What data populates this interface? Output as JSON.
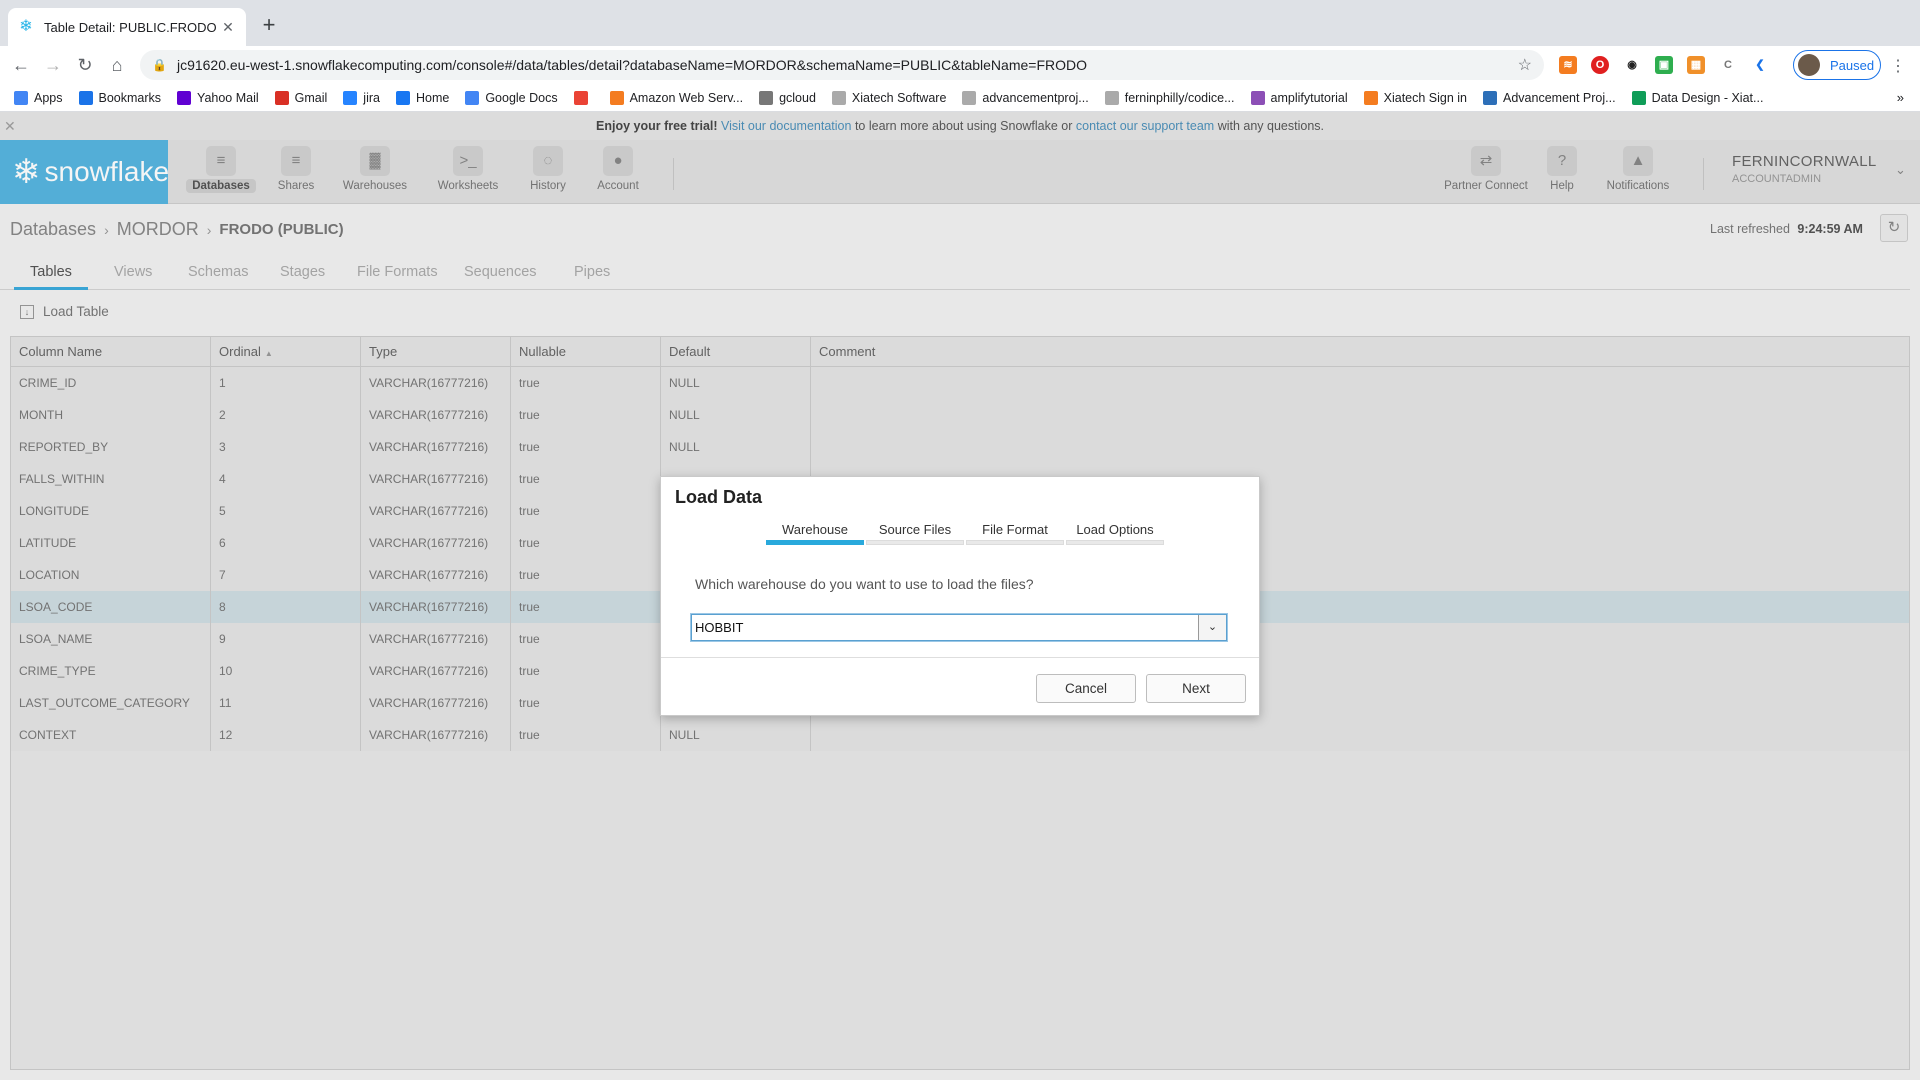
{
  "browser": {
    "tab_title": "Table Detail: PUBLIC.FRODO",
    "url": "jc91620.eu-west-1.snowflakecomputing.com/console#/data/tables/detail?databaseName=MORDOR&schemaName=PUBLIC&tableName=FRODO",
    "profile_label": "Paused",
    "bookmarks": [
      {
        "label": "Apps",
        "icon": "apps-grid-icon",
        "color": "#4285f4"
      },
      {
        "label": "Bookmarks",
        "icon": "star-icon",
        "color": "#1a73e8"
      },
      {
        "label": "Yahoo Mail",
        "icon": "mail-icon",
        "color": "#6001d2"
      },
      {
        "label": "Gmail",
        "icon": "gmail-icon",
        "color": "#d93025"
      },
      {
        "label": "jira",
        "icon": "jira-icon",
        "color": "#2684ff"
      },
      {
        "label": "Home",
        "icon": "facebook-icon",
        "color": "#1877f2"
      },
      {
        "label": "Google Docs",
        "icon": "docs-icon",
        "color": "#4285f4"
      },
      {
        "label": "",
        "icon": "google-icon",
        "color": "#ea4335"
      },
      {
        "label": "Amazon Web Serv...",
        "icon": "aws-icon",
        "color": "#f47c20"
      },
      {
        "label": "gcloud",
        "icon": "gear-icon",
        "color": "#777777"
      },
      {
        "label": "Xiatech Software",
        "icon": "github-icon",
        "color": "#aaaaaa"
      },
      {
        "label": "advancementproj...",
        "icon": "github-icon",
        "color": "#aaaaaa"
      },
      {
        "label": "ferninphilly/codice...",
        "icon": "github-icon",
        "color": "#aaaaaa"
      },
      {
        "label": "amplifytutorial",
        "icon": "amplify-icon",
        "color": "#8c4fb6"
      },
      {
        "label": "Xiatech Sign in",
        "icon": "aws-icon",
        "color": "#f47c20"
      },
      {
        "label": "Advancement Proj...",
        "icon": "db-icon",
        "color": "#2d6fb8"
      },
      {
        "label": "Data Design - Xiat...",
        "icon": "sheets-icon",
        "color": "#0f9d58"
      }
    ]
  },
  "trial": {
    "lead": "Enjoy your free trial!",
    "link1": "Visit our documentation",
    "mid": "to learn more about using Snowflake or",
    "link2": "contact our support team",
    "tail": "with any questions."
  },
  "app": {
    "logo": "snowflake",
    "nav": [
      {
        "label": "Databases",
        "icon": "database-icon",
        "glyph": "≡"
      },
      {
        "label": "Shares",
        "icon": "shares-icon",
        "glyph": "≡"
      },
      {
        "label": "Warehouses",
        "icon": "warehouse-icon",
        "glyph": "▓"
      },
      {
        "label": "Worksheets",
        "icon": "terminal-icon",
        "glyph": ">_"
      },
      {
        "label": "History",
        "icon": "history-icon",
        "glyph": "◌"
      },
      {
        "label": "Account",
        "icon": "account-icon",
        "glyph": "●"
      }
    ],
    "nav_right": [
      {
        "label": "Partner Connect",
        "icon": "partner-connect-icon",
        "glyph": "⇄"
      },
      {
        "label": "Help",
        "icon": "help-icon",
        "glyph": "?"
      },
      {
        "label": "Notifications",
        "icon": "bell-icon",
        "glyph": "▲"
      }
    ],
    "user_name": "FERNINCORNWALL",
    "user_role": "ACCOUNTADMIN"
  },
  "breadcrumb": {
    "root": "Databases",
    "database": "MORDOR",
    "current": "FRODO (PUBLIC)"
  },
  "refresh": {
    "label": "Last refreshed",
    "time": "9:24:59 AM"
  },
  "subtabs": [
    "Tables",
    "Views",
    "Schemas",
    "Stages",
    "File Formats",
    "Sequences",
    "Pipes"
  ],
  "load_table_label": "Load Table",
  "table": {
    "headers": [
      "Column Name",
      "Ordinal",
      "Type",
      "Nullable",
      "Default",
      "Comment"
    ],
    "rows": [
      {
        "name": "CRIME_ID",
        "ordinal": "1",
        "type": "VARCHAR(16777216)",
        "nullable": "true",
        "default": "NULL"
      },
      {
        "name": "MONTH",
        "ordinal": "2",
        "type": "VARCHAR(16777216)",
        "nullable": "true",
        "default": "NULL"
      },
      {
        "name": "REPORTED_BY",
        "ordinal": "3",
        "type": "VARCHAR(16777216)",
        "nullable": "true",
        "default": "NULL"
      },
      {
        "name": "FALLS_WITHIN",
        "ordinal": "4",
        "type": "VARCHAR(16777216)",
        "nullable": "true",
        "default": ""
      },
      {
        "name": "LONGITUDE",
        "ordinal": "5",
        "type": "VARCHAR(16777216)",
        "nullable": "true",
        "default": ""
      },
      {
        "name": "LATITUDE",
        "ordinal": "6",
        "type": "VARCHAR(16777216)",
        "nullable": "true",
        "default": ""
      },
      {
        "name": "LOCATION",
        "ordinal": "7",
        "type": "VARCHAR(16777216)",
        "nullable": "true",
        "default": ""
      },
      {
        "name": "LSOA_CODE",
        "ordinal": "8",
        "type": "VARCHAR(16777216)",
        "nullable": "true",
        "default": ""
      },
      {
        "name": "LSOA_NAME",
        "ordinal": "9",
        "type": "VARCHAR(16777216)",
        "nullable": "true",
        "default": ""
      },
      {
        "name": "CRIME_TYPE",
        "ordinal": "10",
        "type": "VARCHAR(16777216)",
        "nullable": "true",
        "default": ""
      },
      {
        "name": "LAST_OUTCOME_CATEGORY",
        "ordinal": "11",
        "type": "VARCHAR(16777216)",
        "nullable": "true",
        "default": ""
      },
      {
        "name": "CONTEXT",
        "ordinal": "12",
        "type": "VARCHAR(16777216)",
        "nullable": "true",
        "default": "NULL"
      }
    ],
    "selected_row": "LSOA_CODE"
  },
  "modal": {
    "title": "Load Data",
    "steps": [
      "Warehouse",
      "Source Files",
      "File Format",
      "Load Options"
    ],
    "active_step": "Warehouse",
    "question": "Which warehouse do you want to use to load the files?",
    "warehouse_value": "HOBBIT",
    "cancel_label": "Cancel",
    "next_label": "Next"
  },
  "colors": {
    "accent": "#29a9dc",
    "logo_bg": "#57b6e0",
    "selected_row": "#cfdde2"
  }
}
